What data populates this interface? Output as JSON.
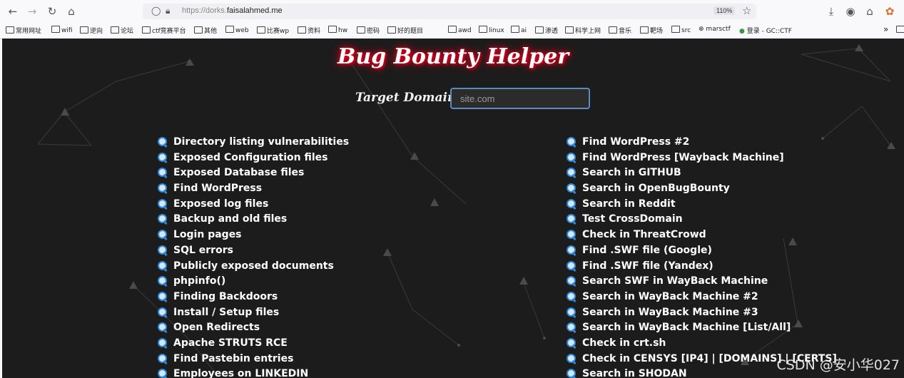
{
  "browser": {
    "url_prefix": "https://dorks.",
    "url_domain": "faisalahmed.me",
    "zoom": "110%",
    "nav_icons": [
      "back-arrow-icon",
      "forward-arrow-icon",
      "reload-icon",
      "home-icon"
    ],
    "bookmarks": [
      "常用网址",
      "wifi",
      "逆向",
      "论坛",
      "ctf竞赛平台",
      "其他",
      "web",
      "比赛wp",
      "资料",
      "hw",
      "密码",
      "好的题目",
      "awd",
      "linux",
      "ai",
      "渗透",
      "科学上网",
      "音乐",
      "靶场",
      "src",
      "marsctf",
      "登录 - GC::CTF"
    ]
  },
  "page": {
    "title": "Bug Bounty Helper",
    "target_label": "Target Domain:",
    "target_placeholder": "site.com",
    "left_dorks": [
      "Directory listing vulnerabilities",
      "Exposed Configuration files",
      "Exposed Database files",
      "Find WordPress",
      "Exposed log files",
      "Backup and old files",
      "Login pages",
      "SQL errors",
      "Publicly exposed documents",
      "phpinfo()",
      "Finding Backdoors",
      "Install / Setup files",
      "Open Redirects",
      "Apache STRUTS RCE",
      "Find Pastebin entries",
      "Employees on LINKEDIN"
    ],
    "right_dorks": [
      "Find WordPress #2",
      "Find WordPress [Wayback Machine]",
      "Search in GITHUB",
      "Search in OpenBugBounty",
      "Search in Reddit",
      "Test CrossDomain",
      "Check in ThreatCrowd",
      "Find .SWF file (Google)",
      "Find .SWF file (Yandex)",
      "Search SWF in WayBack Machine",
      "Search in WayBack Machine #2",
      "Search in WayBack Machine #3",
      "Search in WayBack Machine [List/All]",
      "Check in crt.sh",
      "Check in CENSYS [IP4] | [DOMAINS] | [CERTS]",
      "Search in SHODAN"
    ]
  },
  "watermark": "CSDN @安小华027",
  "colors": {
    "page_bg": "#1c1c1c",
    "title_glow": "#e10020",
    "input_border": "#5c8ac4",
    "search_icon": "#2f87d6"
  }
}
